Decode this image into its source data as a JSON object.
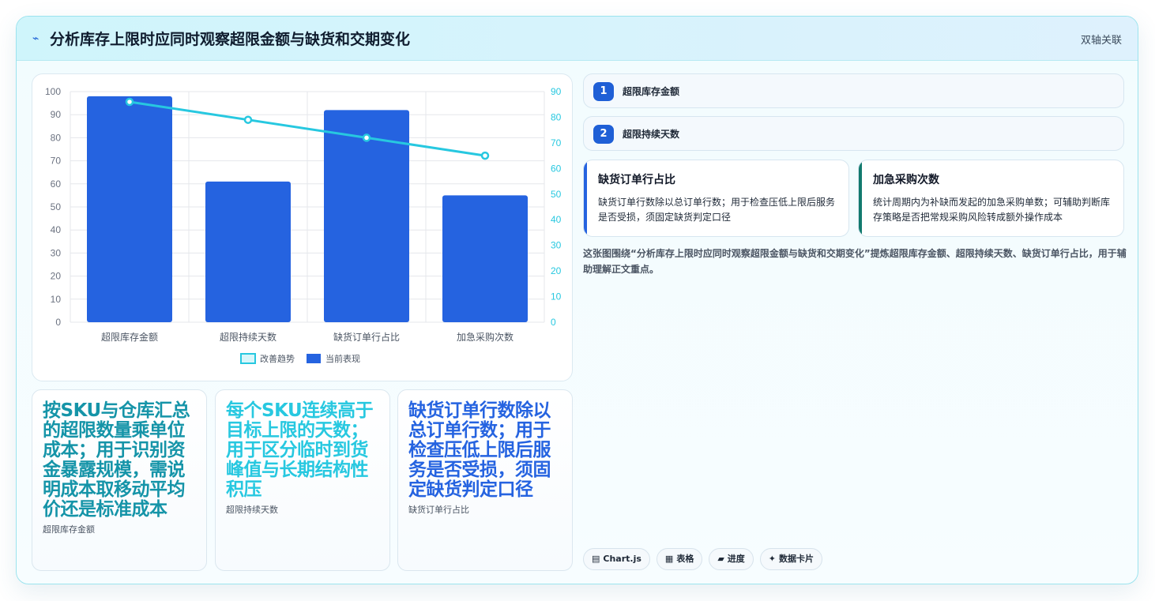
{
  "header": {
    "title": "分析库存上限时应同时观察超限金额与缺货和交期变化",
    "tag": "双轴关联"
  },
  "chart_data": {
    "type": "bar",
    "categories": [
      "超限库存金额",
      "超限持续天数",
      "缺货订单行占比",
      "加急采购次数"
    ],
    "series": [
      {
        "name": "当前表现",
        "type": "bar",
        "axis": "left",
        "values": [
          98,
          61,
          92,
          55
        ]
      },
      {
        "name": "改善趋势",
        "type": "line",
        "axis": "right",
        "values": [
          86,
          79,
          72,
          65
        ]
      }
    ],
    "ylim_left": [
      0,
      100
    ],
    "yticks_left": [
      0,
      10,
      20,
      30,
      40,
      50,
      60,
      70,
      80,
      90,
      100
    ],
    "ylim_right": [
      0,
      90
    ],
    "yticks_right": [
      0,
      10,
      20,
      30,
      40,
      50,
      60,
      70,
      80,
      90
    ],
    "legend": [
      "改善趋势",
      "当前表现"
    ],
    "legend_position": "bottom",
    "grid": true,
    "colors": {
      "bar": "#2563e0",
      "line": "#27c8e0"
    }
  },
  "big_cards": [
    {
      "text": "按SKU与仓库汇总的超限数量乘单位成本；用于识别资金暴露规模，需说明成本取移动平均价还是标准成本",
      "label": "超限库存金额",
      "color": "#1594a8"
    },
    {
      "text": "每个SKU连续高于目标上限的天数；用于区分临时到货峰值与长期结构性积压",
      "label": "超限持续天数",
      "color": "#27c8e0"
    },
    {
      "text": "缺货订单行数除以总订单行数；用于检查压低上限后服务是否受损，须固定缺货判定口径",
      "label": "缺货订单行占比",
      "color": "#2563e0"
    }
  ],
  "steps": [
    {
      "num": "1",
      "label": "超限库存金额"
    },
    {
      "num": "2",
      "label": "超限持续天数"
    }
  ],
  "info_cards": [
    {
      "title": "缺货订单行占比",
      "desc": "缺货订单行数除以总订单行数；用于检查压低上限后服务是否受损，须固定缺货判定口径",
      "color": "#2563e0"
    },
    {
      "title": "加急采购次数",
      "desc": "统计周期内为补缺而发起的加急采购单数；可辅助判断库存策略是否把常规采购风险转成额外操作成本",
      "color": "#127a6e"
    }
  ],
  "description": "这张图围绕“分析库存上限时应同时观察超限金额与缺货和交期变化”提炼超限库存金额、超限持续天数、缺货订单行占比，用于辅助理解正文重点。",
  "chips": [
    {
      "icon": "▤",
      "label": "Chart.js"
    },
    {
      "icon": "▦",
      "label": "表格"
    },
    {
      "icon": "▰",
      "label": "进度"
    },
    {
      "icon": "✦",
      "label": "数据卡片"
    }
  ]
}
